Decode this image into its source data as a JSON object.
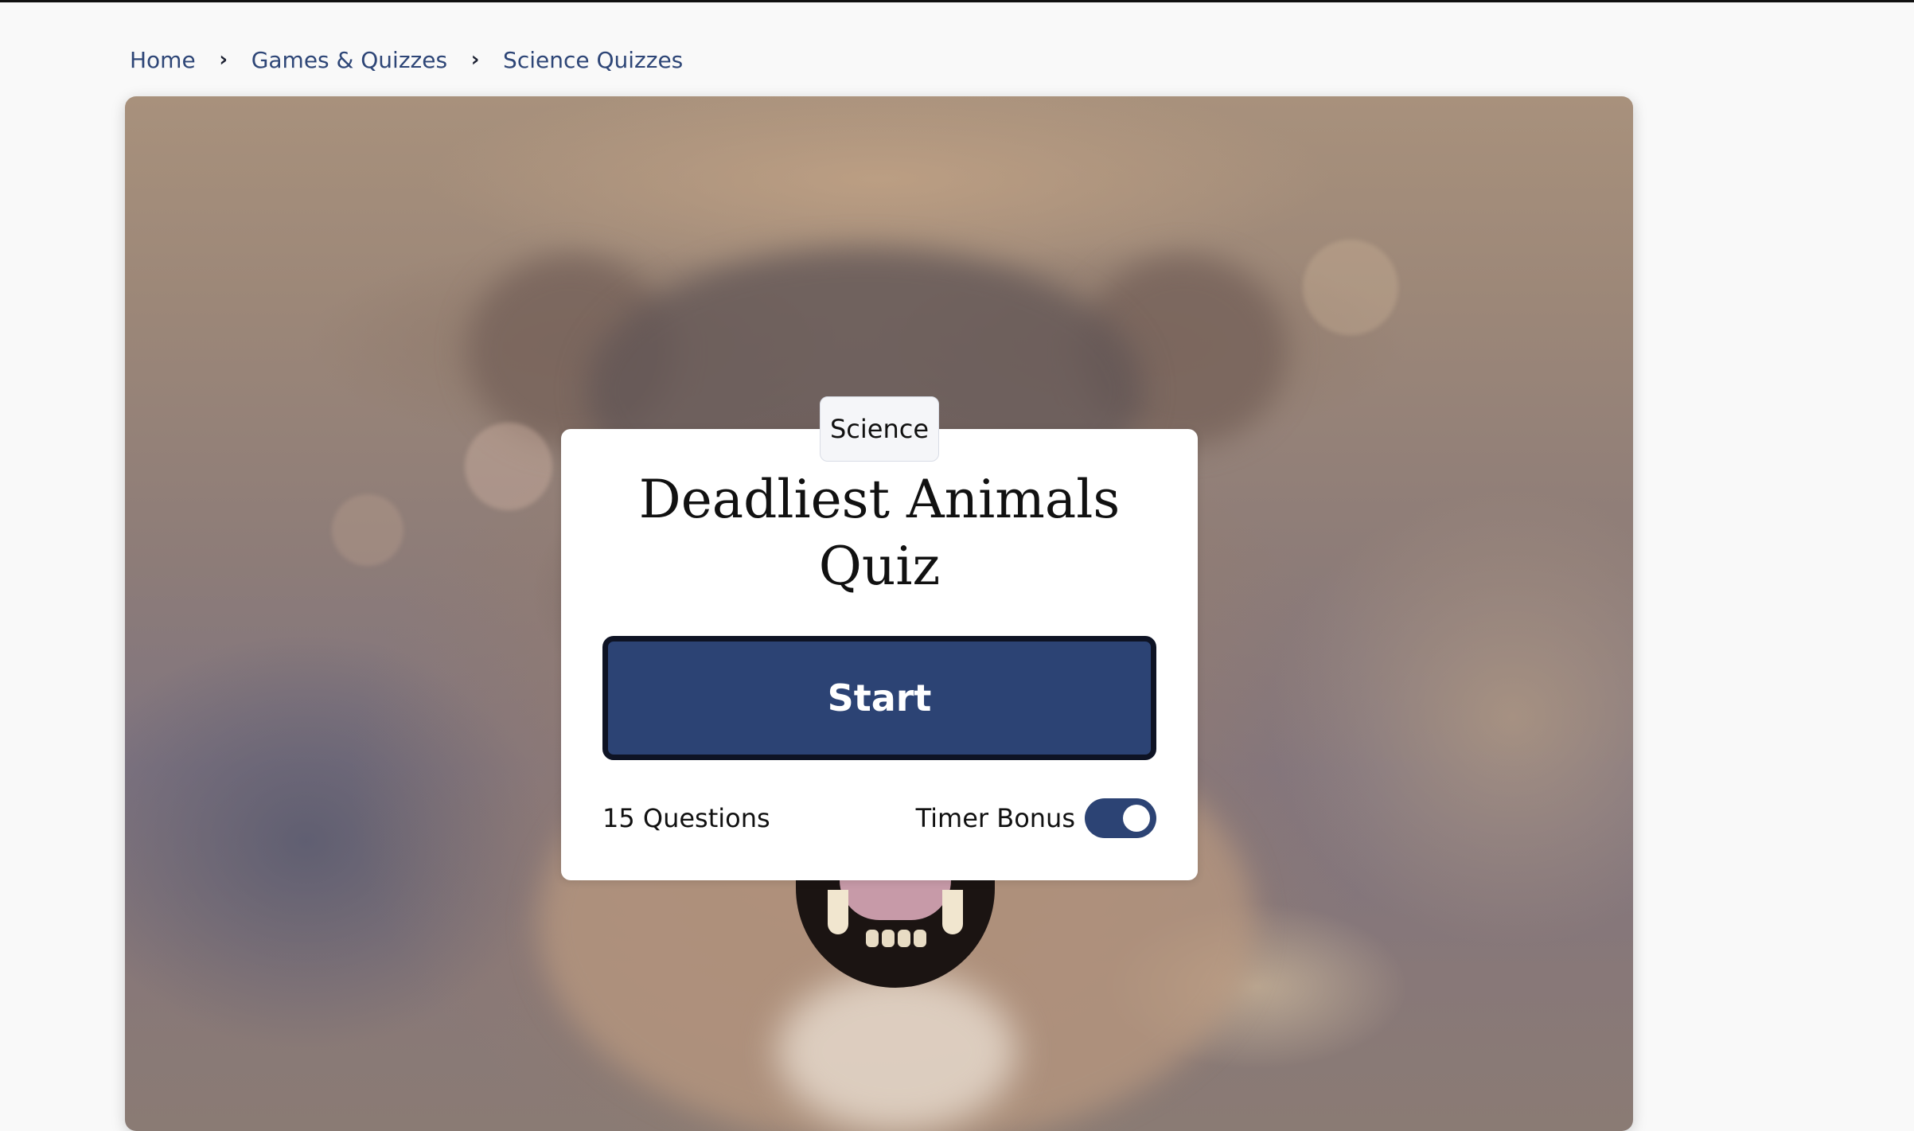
{
  "breadcrumb": {
    "items": [
      "Home",
      "Games & Quizzes",
      "Science Quizzes"
    ],
    "separator": "›"
  },
  "quiz": {
    "category": "Science",
    "title_line1": "Deadliest Animals",
    "title_line2": "Quiz",
    "start_label": "Start",
    "questions_label": "15 Questions",
    "timer_bonus_label": "Timer Bonus",
    "timer_bonus_on": true
  },
  "hero": {
    "image": "lioness-snarling-photo"
  },
  "colors": {
    "accent": "#2c4374",
    "breadcrumb_link": "#2e4677",
    "card_background": "#ffffff",
    "page_background": "#f9f9f9"
  }
}
